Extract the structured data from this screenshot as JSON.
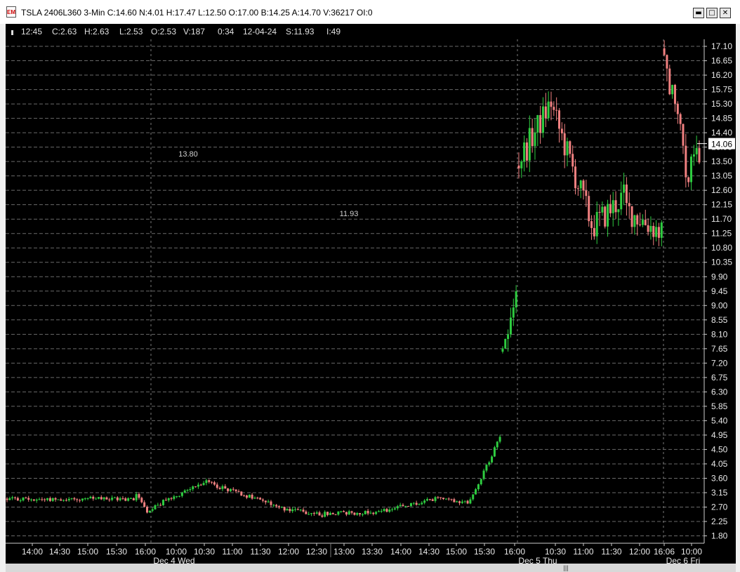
{
  "window": {
    "title": "TSLA 2406L360 3-Min C:14.60 N:4.01 H:17.47 L:12.50 O:17.00 B:14.25 A:14.70 V:36217 OI:0",
    "app_icon": "chart-app-icon",
    "buttons": {
      "minimize": "▬",
      "maximize": "□",
      "close": "✕"
    }
  },
  "info": {
    "time": "12:45",
    "close": "C:2.63",
    "high": "H:2.63",
    "low": "L:2.53",
    "open": "O:2.53",
    "volume": "V:187",
    "duration": "0:34",
    "date": "12-04-24",
    "stock": "S:11.93",
    "interval": "I:49"
  },
  "chart_data": {
    "type": "candlestick",
    "background": "#000000",
    "up_color": "#2ecc40",
    "down_color": "#f08080",
    "grid": true,
    "ylim": [
      1.57,
      17.32
    ],
    "y_ticks": [
      "17.10",
      "16.65",
      "16.20",
      "15.75",
      "15.30",
      "14.85",
      "14.40",
      "13.95",
      "13.50",
      "13.05",
      "12.60",
      "12.15",
      "11.70",
      "11.25",
      "10.80",
      "10.35",
      "9.90",
      "9.45",
      "9.00",
      "8.55",
      "8.10",
      "7.65",
      "7.20",
      "6.75",
      "6.30",
      "5.85",
      "5.40",
      "4.95",
      "4.50",
      "4.05",
      "3.60",
      "3.15",
      "2.70",
      "2.25",
      "1.80"
    ],
    "x_labels": [
      "14:00",
      "14:30",
      "15:00",
      "15:30",
      "16:00",
      "10:00",
      "10:30",
      "11:00",
      "11:30",
      "12:00",
      "12:30",
      "13:00",
      "13:30",
      "14:00",
      "14:30",
      "15:00",
      "15:30",
      "16:00",
      "10:30",
      "11:00",
      "11:30",
      "12:00",
      "16:06",
      "10:00"
    ],
    "day_labels": [
      "Dec 4 Wed",
      "Dec 5 Thu",
      "Dec 6 Fri"
    ],
    "current_price": "14.06",
    "annotations": [
      "13.80",
      "11.93"
    ],
    "segments": [
      {
        "from": 0,
        "to": 48,
        "start": 2.95,
        "end": 2.95
      },
      {
        "from": 48,
        "to": 52,
        "start": 3.1,
        "end": 2.65
      },
      {
        "from": 52,
        "to": 73,
        "start": 2.6,
        "end": 3.5
      },
      {
        "from": 73,
        "to": 100,
        "start": 3.5,
        "end": 2.75
      },
      {
        "from": 100,
        "to": 118,
        "start": 2.7,
        "end": 2.45
      },
      {
        "from": 118,
        "to": 138,
        "start": 2.5,
        "end": 2.55
      },
      {
        "from": 138,
        "to": 162,
        "start": 2.55,
        "end": 3.0
      },
      {
        "from": 162,
        "to": 172,
        "start": 3.0,
        "end": 2.8
      },
      {
        "from": 172,
        "to": 184,
        "start": 2.9,
        "end": 5.05
      },
      {
        "from": 184,
        "to": 190,
        "start": 7.6,
        "end": 9.9
      },
      {
        "from": 190,
        "to": 203,
        "start": 13.5,
        "end": 15.5
      },
      {
        "from": 203,
        "to": 218,
        "start": 15.0,
        "end": 11.3
      },
      {
        "from": 218,
        "to": 230,
        "start": 11.5,
        "end": 12.5
      },
      {
        "from": 230,
        "to": 244,
        "start": 12.0,
        "end": 11.2
      },
      {
        "from": 244,
        "to": 252,
        "start": 16.8,
        "end": 13.5
      },
      {
        "from": 252,
        "to": 258,
        "start": 13.0,
        "end": 14.06
      }
    ],
    "candle_count": 258
  }
}
